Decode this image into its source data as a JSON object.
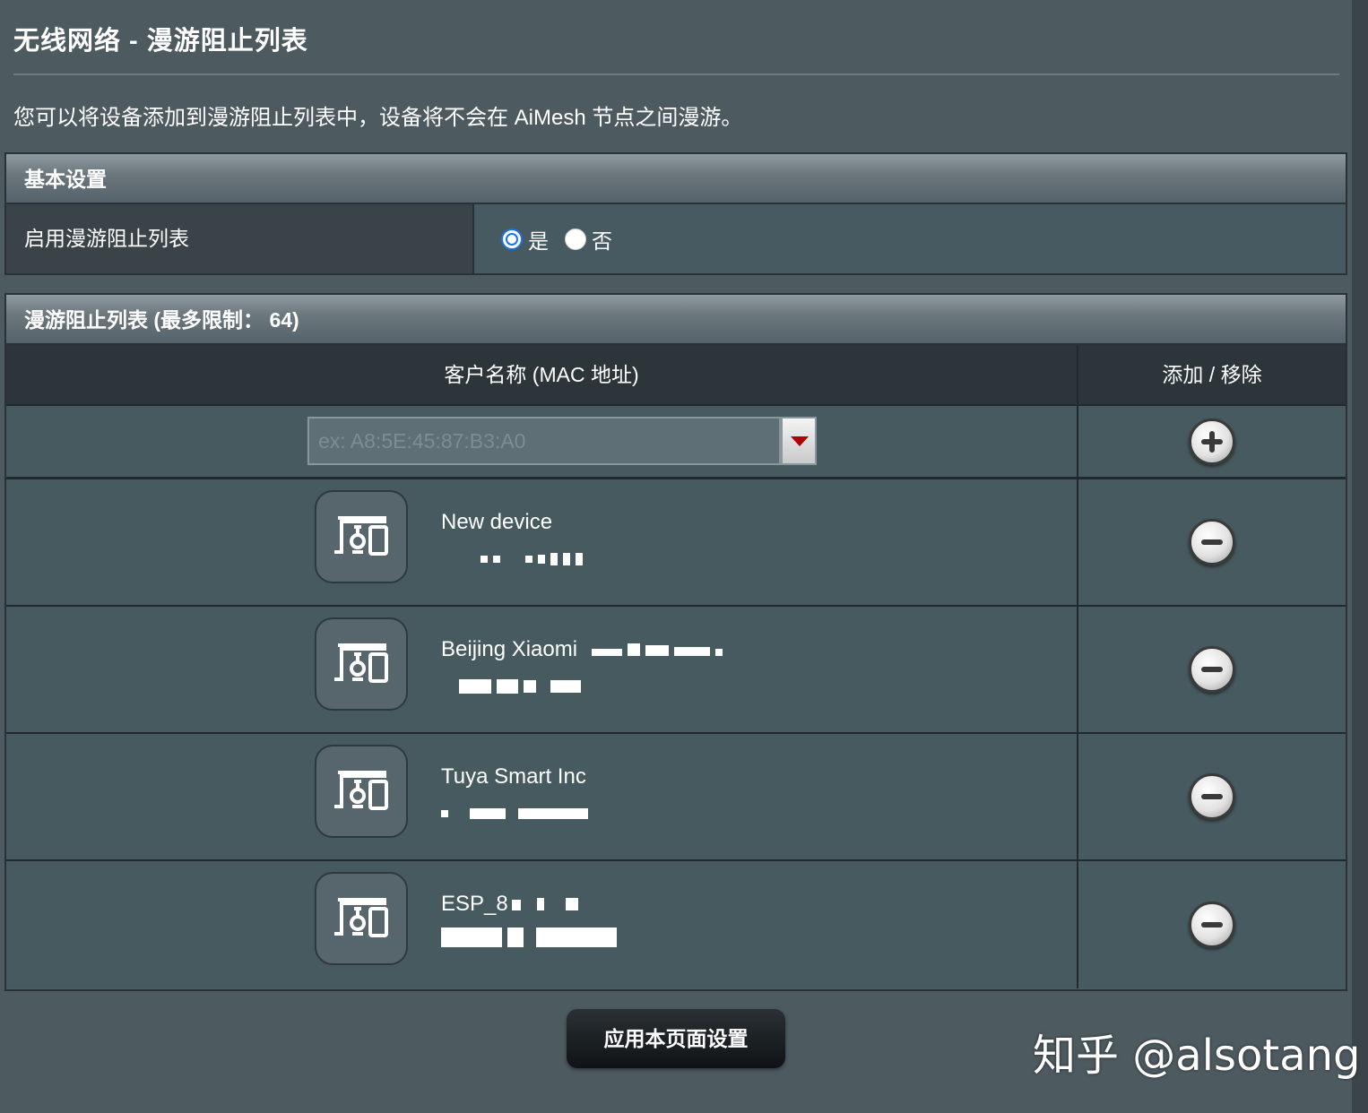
{
  "page": {
    "title": "无线网络 - 漫游阻止列表",
    "description": "您可以将设备添加到漫游阻止列表中，设备将不会在 AiMesh 节点之间漫游。"
  },
  "basic_settings": {
    "header": "基本设置",
    "enable_label": "启用漫游阻止列表",
    "options": [
      {
        "label": "是",
        "selected": true
      },
      {
        "label": "否",
        "selected": false
      }
    ]
  },
  "block_list": {
    "header": "漫游阻止列表 (最多限制： 64)",
    "col_client": "客户名称 (MAC 地址)",
    "col_action": "添加 / 移除",
    "mac_placeholder": "ex: A8:5E:45:87:B3:A0",
    "devices": [
      {
        "name": "New device"
      },
      {
        "name": "Beijing Xiaomi"
      },
      {
        "name": "Tuya Smart Inc"
      },
      {
        "name": "ESP_8"
      }
    ]
  },
  "apply_button": "应用本页面设置",
  "watermark": "知乎 @alsotang",
  "icons": {
    "device": "device-icon",
    "add": "plus-circle-icon",
    "remove": "minus-circle-icon",
    "dropdown": "caret-down-icon"
  },
  "colors": {
    "background": "#4d5a60",
    "radio_accent": "#1a73e8",
    "dropdown_arrow": "#b20000"
  }
}
